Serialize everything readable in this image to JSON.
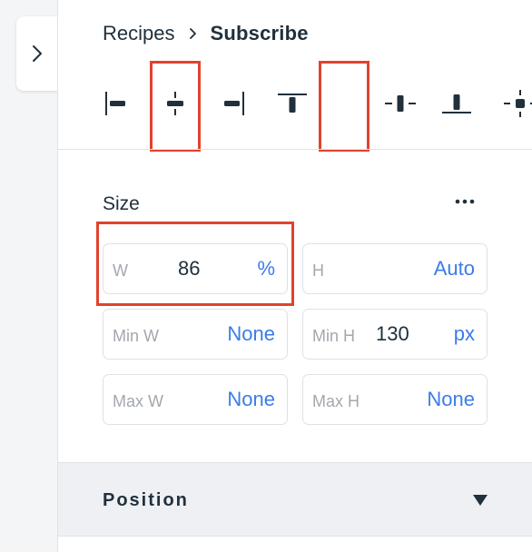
{
  "breadcrumb": {
    "parent": "Recipes",
    "current": "Subscribe"
  },
  "alignment": {
    "options": [
      {
        "name": "align-left-icon",
        "selected": false
      },
      {
        "name": "align-center-horizontal-icon",
        "selected": true
      },
      {
        "name": "align-right-icon",
        "selected": false
      },
      {
        "name": "align-top-icon",
        "selected": false
      },
      {
        "name": "align-center-vertical-icon",
        "selected": true
      },
      {
        "name": "align-bottom-icon",
        "selected": false
      },
      {
        "name": "align-center-both-icon",
        "selected": false
      }
    ]
  },
  "size": {
    "title": "Size",
    "width": {
      "label": "W",
      "value": "86",
      "unit": "%"
    },
    "height": {
      "label": "H",
      "value": "",
      "unit": "Auto"
    },
    "min_width": {
      "label": "Min W",
      "value": "",
      "unit": "None"
    },
    "min_height": {
      "label": "Min H",
      "value": "130",
      "unit": "px"
    },
    "max_width": {
      "label": "Max W",
      "value": "",
      "unit": "None"
    },
    "max_height": {
      "label": "Max H",
      "value": "",
      "unit": "None"
    }
  },
  "position": {
    "label": "Position"
  },
  "colors": {
    "accent": "#3b7ce8",
    "highlight": "#e0432e",
    "text": "#20303c",
    "muted": "#a3a8ae"
  }
}
